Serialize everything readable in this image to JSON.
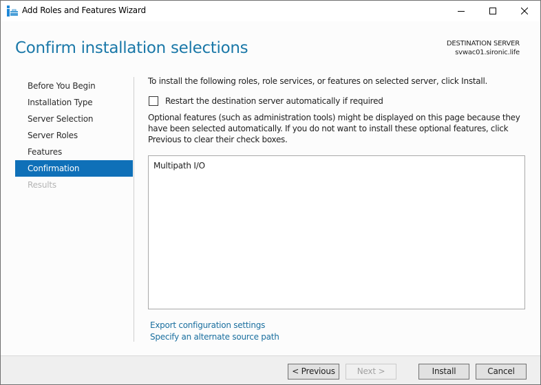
{
  "window": {
    "title": "Add Roles and Features Wizard",
    "icon": "server-manager-icon",
    "controls": {
      "minimize": "minimize-icon",
      "maximize": "maximize-icon",
      "close": "close-icon"
    }
  },
  "header": {
    "title": "Confirm installation selections",
    "destination_label": "DESTINATION SERVER",
    "destination_server": "svwac01.sironic.life"
  },
  "nav": {
    "items": [
      {
        "label": "Before You Begin",
        "state": "normal"
      },
      {
        "label": "Installation Type",
        "state": "normal"
      },
      {
        "label": "Server Selection",
        "state": "normal"
      },
      {
        "label": "Server Roles",
        "state": "normal"
      },
      {
        "label": "Features",
        "state": "normal"
      },
      {
        "label": "Confirmation",
        "state": "active"
      },
      {
        "label": "Results",
        "state": "disabled"
      }
    ]
  },
  "content": {
    "intro": "To install the following roles, role services, or features on selected server, click Install.",
    "restart_checkbox": {
      "label": "Restart the destination server automatically if required",
      "checked": false
    },
    "optional_text": "Optional features (such as administration tools) might be displayed on this page because they have been selected automatically. If you do not want to install these optional features, click Previous to clear their check boxes.",
    "features": [
      "Multipath I/O"
    ],
    "links": {
      "export": "Export configuration settings",
      "source": "Specify an alternate source path"
    }
  },
  "footer": {
    "previous": "< Previous",
    "next": "Next >",
    "install": "Install",
    "cancel": "Cancel"
  },
  "colors": {
    "accent": "#0f70b8",
    "title_blue": "#1a78a8",
    "link": "#1a6f9f",
    "disabled_text": "#b4b4b4"
  }
}
